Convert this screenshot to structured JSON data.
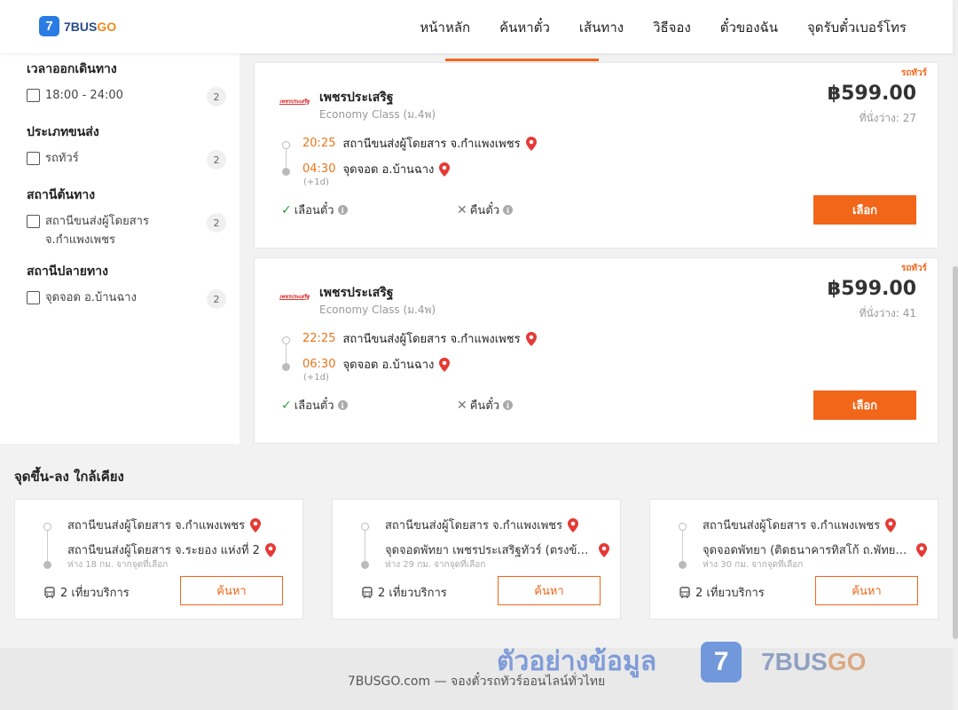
{
  "header": {
    "logo_number": "7",
    "logo_brand": "7BUS",
    "logo_brand_go": "GO",
    "nav": [
      "หน้าหลัก",
      "ค้นหาตั๋ว",
      "เส้นทาง",
      "วิธีจอง",
      "ตั๋วของฉัน",
      "จุดรับตั๋วเบอร์โทร"
    ]
  },
  "sidebar": {
    "groups": [
      {
        "title": "เวลาออกเดินทาง",
        "option": "18:00 - 24:00",
        "count": "2"
      },
      {
        "title": "ประเภทขนส่ง",
        "option": "รถทัวร์",
        "count": "2"
      },
      {
        "title": "สถานีต้นทาง",
        "option": "สถานีขนส่งผู้โดยสาร จ.กำแพงเพชร",
        "count": "2"
      },
      {
        "title": "สถานีปลายทาง",
        "option": "จุดจอด อ.บ้านฉาง",
        "count": "2"
      }
    ]
  },
  "trips": [
    {
      "tag": "รถทัวร์",
      "operator_logo": "เพชรประเสริฐ",
      "operator": "เพชรประเสริฐ",
      "class": "Economy Class (ม.4พ)",
      "price": "฿599.00",
      "seats": "ที่นั่งว่าง: 27",
      "depart_time": "20:25",
      "depart_station": "สถานีขนส่งผู้โดยสาร จ.กำแพงเพชร",
      "arrive_time": "04:30",
      "arrive_station": "จุดจอด อ.บ้านฉาง",
      "next_day": "(+1d)",
      "feature_seat": "เลือนตั๋ว",
      "feature_refund": "คืนตั๋ว",
      "select_label": "เลือก"
    },
    {
      "tag": "รถทัวร์",
      "operator_logo": "เพชรประเสริฐ",
      "operator": "เพชรประเสริฐ",
      "class": "Economy Class (ม.4พ)",
      "price": "฿599.00",
      "seats": "ที่นั่งว่าง: 41",
      "depart_time": "22:25",
      "depart_station": "สถานีขนส่งผู้โดยสาร จ.กำแพงเพชร",
      "arrive_time": "06:30",
      "arrive_station": "จุดจอด อ.บ้านฉาง",
      "next_day": "(+1d)",
      "feature_seat": "เลือนตั๋ว",
      "feature_refund": "คืนตั๋ว",
      "select_label": "เลือก"
    }
  ],
  "nearby": {
    "title": "จุดขึ้น-ลง ใกล้เคียง",
    "items": [
      {
        "from": "สถานีขนส่งผู้โดยสาร จ.กำแพงเพชร",
        "to": "สถานีขนส่งผู้โดยสาร จ.ระยอง แห่งที่ 2",
        "distance": "ห่าง 18 กม. จากจุดที่เลือก",
        "trips": "2 เที่ยวบริการ",
        "search_label": "ค้นหา"
      },
      {
        "from": "สถานีขนส่งผู้โดยสาร จ.กำแพงเพชร",
        "to": "จุดจอดพัทยา เพชรประเสริฐทัวร์ (ตรงข้ามโรงเรียน)",
        "distance": "ห่าง 29 กม. จากจุดที่เลือก",
        "trips": "2 เที่ยวบริการ",
        "search_label": "ค้นหา"
      },
      {
        "from": "สถานีขนส่งผู้โดยสาร จ.กำแพงเพชร",
        "to": "จุดจอดพัทยา (ติดธนาคารทิสโก้ ถ.พัทยาใต้)",
        "distance": "ห่าง 30 กม. จากจุดที่เลือก",
        "trips": "2 เที่ยวบริการ",
        "search_label": "ค้นหา"
      }
    ]
  },
  "footer": {
    "text": "7BUSGO.com — จองตั๋วรถทัวร์ออนไลน์ทั่วไทย"
  },
  "watermark": {
    "text": "ตัวอย่างข้อมูล",
    "badge": "7",
    "brand": "7BUS",
    "brand_go": "GO"
  },
  "colors": {
    "accent": "#f2661a",
    "brand_blue": "#2a7be4",
    "time_orange": "#e8761a",
    "check_green": "#2b9e3c"
  },
  "icons": [
    "map-pin-icon",
    "check-icon",
    "cross-icon",
    "info-icon",
    "bus-icon"
  ]
}
